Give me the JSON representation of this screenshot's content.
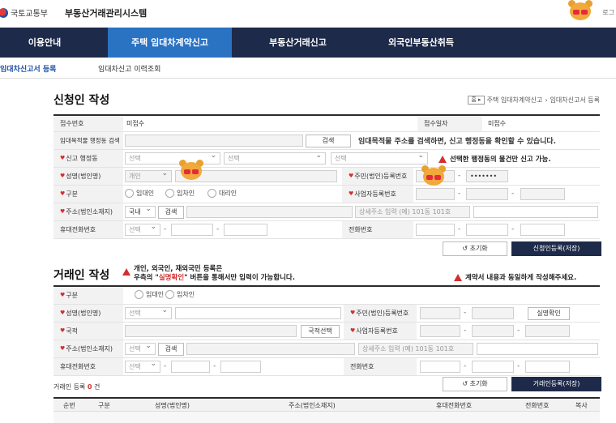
{
  "header": {
    "ministry": "국토교통부",
    "system_title": "부동산거래관리시스템",
    "login": "로그"
  },
  "nav": [
    "이용안내",
    "주택 임대차계약신고",
    "부동산거래신고",
    "외국인부동산취득"
  ],
  "subnav": [
    "임대차신고서 등록",
    "임대차신고 이력조회"
  ],
  "applicant": {
    "title": "신청인 작성",
    "breadcrumb": {
      "home": "홈",
      "path1": "주택 임대차계약신고",
      "path2": "임대차신고서 등록"
    },
    "receipt_no_label": "접수번호",
    "receipt_no": "미접수",
    "receipt_date_label": "접수일자",
    "receipt_date": "미접수",
    "dong_search_label": "임대목적물 행정동 검색",
    "search_btn": "검색",
    "dong_search_notice": "임대목적물 주소를 검색하면, 신고 행정동을 확인할 수 있습니다.",
    "report_dong_label": "신고 행정동",
    "select_ph": "선택",
    "dong_warning": "선택한 행정동의 물건만 신고 가능.",
    "name_label": "성명(법인명)",
    "name_type": "개인",
    "resident_no_label": "주민(법인)등록번호",
    "resident_no_masked": "•••••••",
    "type_label": "구분",
    "type_options": [
      "임대인",
      "임차인",
      "대리인"
    ],
    "biz_no_label": "사업자등록번호",
    "address_label": "주소(법인소재지)",
    "addr_country": "국내",
    "addr_search": "검색",
    "addr_detail_ph": "상세주소 입력 (예) 101동 101호",
    "mobile_label": "휴대전화번호",
    "phone_label": "전화번호",
    "reset_btn": "초기화",
    "register_btn": "신청인등록(저장)"
  },
  "party": {
    "title": "거래인 작성",
    "notice_line1": "개인, 외국인, 재외국민 등록은",
    "notice_line2_prefix": "우측의 \"",
    "notice_line2_highlight": "실명확인",
    "notice_line2_suffix": "\" 버튼을 통해서만 입력이 가능합니다.",
    "right_warning": "계약서 내용과 동일하게 작성해주세요.",
    "type_label": "구분",
    "type_options": [
      "임대인",
      "임차인"
    ],
    "name_label": "성명(법인명)",
    "select_ph": "선택",
    "resident_no_label": "주민(법인)등록번호",
    "verify_btn": "실명확인",
    "nationality_label": "국적",
    "nationality_btn": "국적선택",
    "biz_no_label": "사업자등록번호",
    "address_label": "주소(법인소재지)",
    "addr_search": "검색",
    "addr_detail_ph": "상세주소 입력 (예) 101동 101호",
    "mobile_label": "휴대전화번호",
    "phone_label": "전화번호",
    "reset_btn": "초기화",
    "register_btn": "거래인등록(저장)",
    "count_prefix": "거래인 등록",
    "count": "0",
    "count_suffix": "건",
    "columns": [
      "순번",
      "구분",
      "성명(법인명)",
      "주소(법인소재지)",
      "휴대전화번호",
      "전화번호",
      "복사"
    ]
  },
  "colors": {
    "nav_bg": "#1e2a4a",
    "nav_active": "#2a72c2",
    "required": "#d32f2f"
  }
}
